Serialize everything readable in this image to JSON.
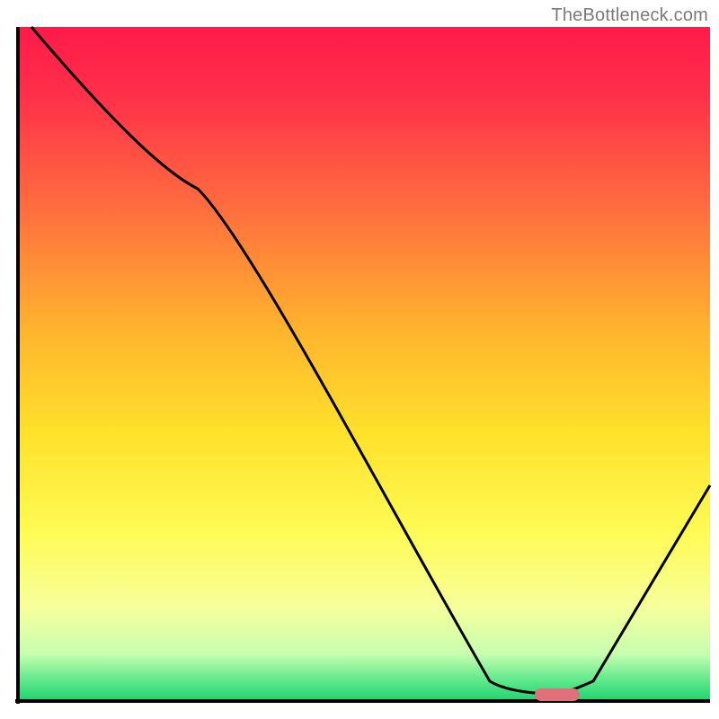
{
  "watermark": "TheBottleneck.com",
  "chart_data": {
    "type": "line",
    "title": "",
    "xlabel": "",
    "ylabel": "",
    "xlim": [
      0,
      100
    ],
    "ylim": [
      0,
      100
    ],
    "grid": false,
    "series": [
      {
        "name": "bottleneck-curve",
        "x": [
          2,
          26,
          68,
          77,
          79,
          82,
          100
        ],
        "y": [
          100,
          76,
          3,
          1,
          1,
          3,
          32
        ]
      }
    ],
    "marker": {
      "name": "optimal-pill",
      "x_start": 75,
      "x_end": 81,
      "y": 1,
      "color": "#e0707a"
    },
    "background_gradient": {
      "stops": [
        {
          "pct": 0,
          "color": "#ff1a4a"
        },
        {
          "pct": 10,
          "color": "#ff2f4a"
        },
        {
          "pct": 26,
          "color": "#ff6a3f"
        },
        {
          "pct": 45,
          "color": "#ffb42e"
        },
        {
          "pct": 60,
          "color": "#ffe12b"
        },
        {
          "pct": 75,
          "color": "#fffb55"
        },
        {
          "pct": 86,
          "color": "#f7ff9c"
        },
        {
          "pct": 93,
          "color": "#c7ffb0"
        },
        {
          "pct": 97,
          "color": "#5de88b"
        },
        {
          "pct": 100,
          "color": "#1fd36f"
        }
      ]
    },
    "axis_color": "#000000",
    "line_color": "#000000",
    "line_width": 3
  }
}
